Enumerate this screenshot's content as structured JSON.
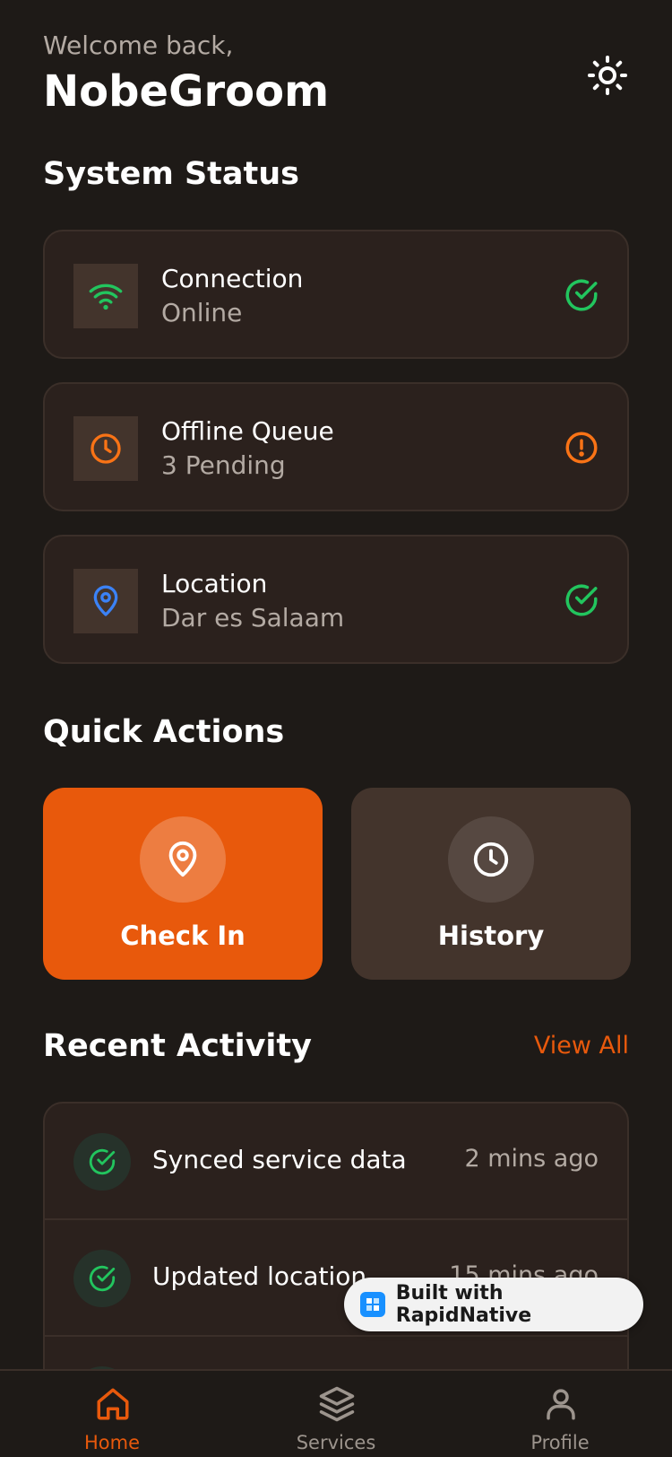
{
  "header": {
    "welcome": "Welcome back,",
    "username": "NobeGroom",
    "theme_icon": "sun-icon"
  },
  "system_status": {
    "title": "System Status",
    "items": [
      {
        "title": "Connection",
        "subtitle": "Online",
        "icon": "wifi-icon",
        "status_icon": "check-circle-icon",
        "accent": "#22c55e"
      },
      {
        "title": "Offline Queue",
        "subtitle": "3 Pending",
        "icon": "clock-icon",
        "status_icon": "alert-circle-icon",
        "accent": "#f97316"
      },
      {
        "title": "Location",
        "subtitle": "Dar es Salaam",
        "icon": "map-pin-icon",
        "status_icon": "check-circle-icon",
        "accent": "#3b82f6"
      }
    ]
  },
  "quick_actions": {
    "title": "Quick Actions",
    "items": [
      {
        "label": "Check In",
        "icon": "map-pin-icon",
        "color": "#e8590c"
      },
      {
        "label": "History",
        "icon": "clock-icon",
        "color": "#43342c"
      }
    ]
  },
  "recent_activity": {
    "title": "Recent Activity",
    "view_all": "View All",
    "items": [
      {
        "text": "Synced service data",
        "time": "2 mins ago",
        "icon": "check-circle-icon"
      },
      {
        "text": "Updated location",
        "time": "15 mins ago",
        "icon": "check-circle-icon"
      }
    ]
  },
  "badge": {
    "text": "Built with RapidNative"
  },
  "tabs": [
    {
      "label": "Home",
      "icon": "home-icon",
      "active": true
    },
    {
      "label": "Services",
      "icon": "layers-icon",
      "active": false
    },
    {
      "label": "Profile",
      "icon": "user-icon",
      "active": false
    }
  ],
  "colors": {
    "background": "#1e1a17",
    "card": "#2b211d",
    "accent": "#e8590c",
    "success": "#22c55e"
  }
}
